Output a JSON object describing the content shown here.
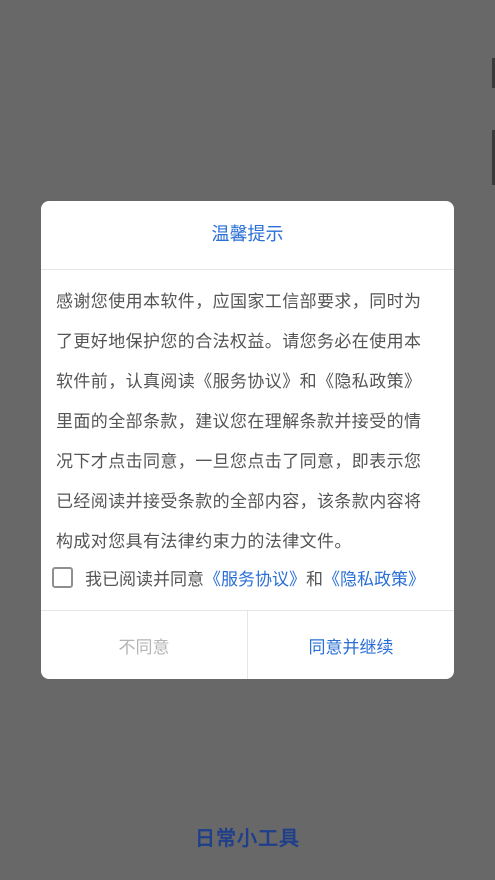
{
  "dialog": {
    "title": "温馨提示",
    "body_lines": [
      "感谢您使用本软件，应国家工信部要求，同时为",
      "了更好地保护您的合法权益。请您务必在使用本",
      "软件前，认真阅读《服务协议》和《隐私政策》",
      "里面的全部条款，建议您在理解条款并接受的情",
      "况下才点击同意，一旦您点击了同意，即表示您",
      "已经阅读并接受条款的全部内容，该条款内容将",
      "构成对您具有法律约束力的法律文件。"
    ],
    "agree_checkbox": {
      "checked": false,
      "prefix": "我已阅读并同意",
      "service_link": "《服务协议》",
      "conjunction": "和",
      "privacy_link": "《隐私政策》"
    },
    "buttons": {
      "disagree": "不同意",
      "agree": "同意并继续"
    }
  },
  "footer": {
    "app_name": "日常小工具"
  },
  "colors": {
    "accent": "#2a6fd6",
    "overlay": "#686868",
    "footer_text": "#1f3f8a"
  }
}
